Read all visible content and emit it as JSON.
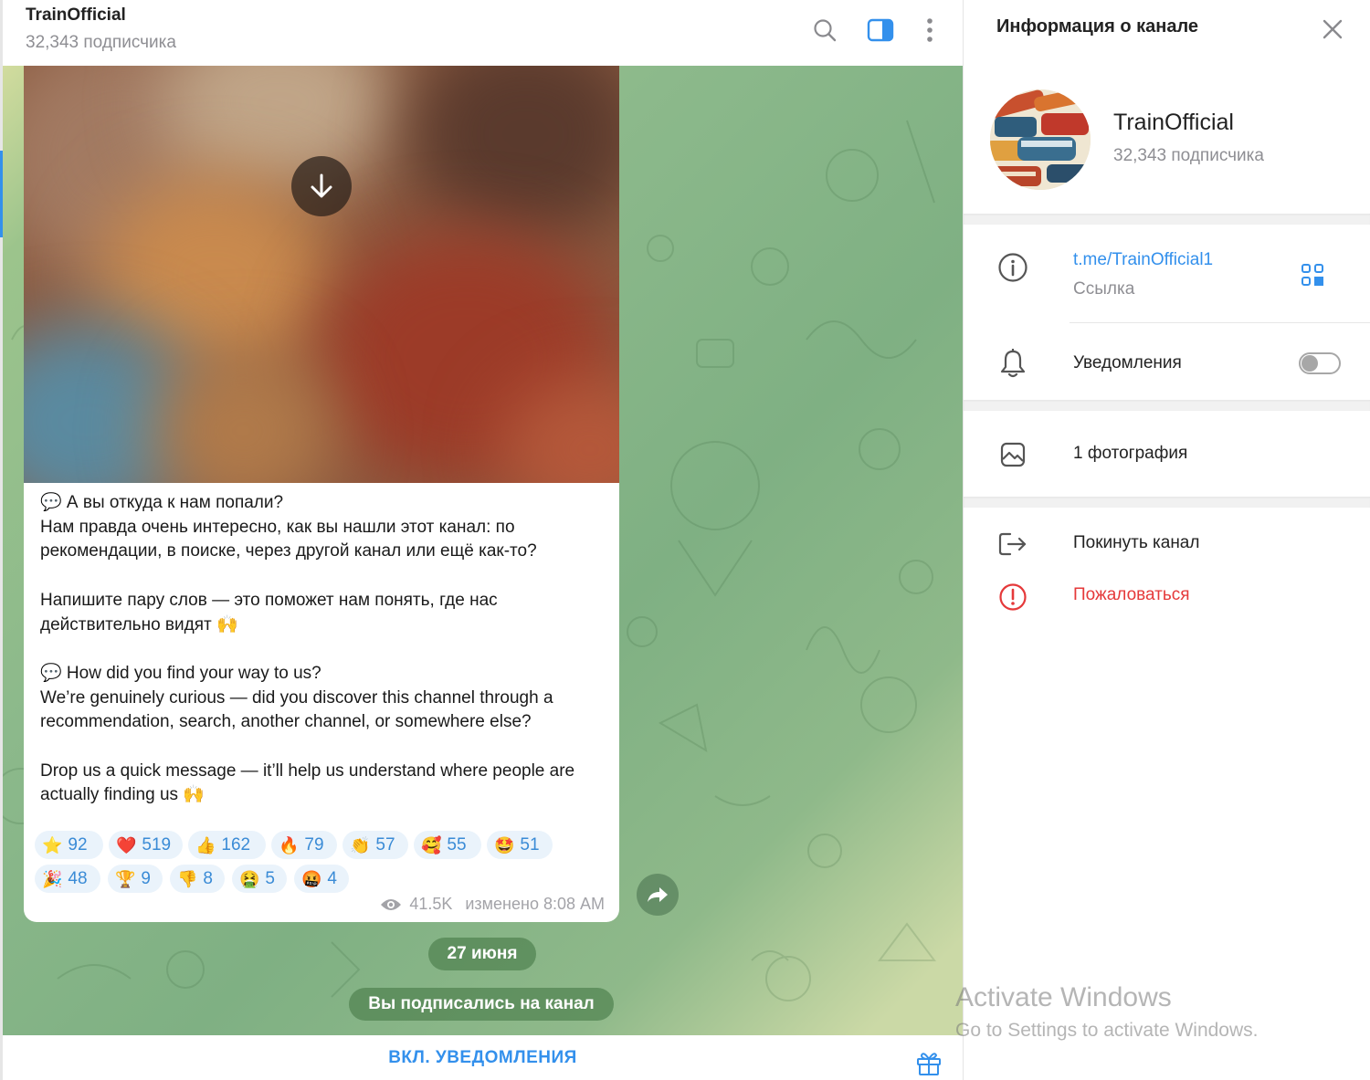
{
  "header": {
    "title": "TrainOfficial",
    "subtitle": "32,343 подписчика",
    "icons": [
      "search-icon",
      "sidebar-toggle-icon",
      "more-vertical-icon"
    ]
  },
  "message": {
    "text": "💬 А вы откуда к нам попали?\nНам правда очень интересно, как вы нашли этот канал: по рекомендации, в поиске, через другой канал или ещё как-то?\n\nНапишите пару слов — это поможет нам понять, где нас действительно видят 🙌\n\n💬 How did you find your way to us?\nWe’re genuinely curious — did you discover this channel through a recommendation, search, another channel, or somewhere else?\n\nDrop us a quick message — it’ll help us understand where people are actually finding us 🙌",
    "reactions": [
      {
        "emoji": "⭐",
        "count": "92"
      },
      {
        "emoji": "❤️",
        "count": "519"
      },
      {
        "emoji": "👍",
        "count": "162"
      },
      {
        "emoji": "🔥",
        "count": "79"
      },
      {
        "emoji": "👏",
        "count": "57"
      },
      {
        "emoji": "🥰",
        "count": "55"
      },
      {
        "emoji": "🤩",
        "count": "51"
      },
      {
        "emoji": "🎉",
        "count": "48"
      },
      {
        "emoji": "🏆",
        "count": "9"
      },
      {
        "emoji": "👎",
        "count": "8"
      },
      {
        "emoji": "🤮",
        "count": "5"
      },
      {
        "emoji": "🤬",
        "count": "4"
      }
    ],
    "views": "41.5K",
    "edited_time": "изменено 8:08 AM"
  },
  "service": {
    "date": "27 июня",
    "joined": "Вы подписались на канал"
  },
  "bottom": {
    "notify_label": "ВКЛ. УВЕДОМЛЕНИЯ"
  },
  "panel": {
    "title": "Информация о канале",
    "channel_name": "TrainOfficial",
    "subscribers": "32,343 подписчика",
    "link": "t.me/TrainOfficial1",
    "link_caption": "Ссылка",
    "notifications_label": "Уведомления",
    "notifications_on": false,
    "photos_label": "1 фотография",
    "leave_label": "Покинуть канал",
    "report_label": "Пожаловаться"
  },
  "watermark": {
    "line1": "Activate Windows",
    "line2": "Go to Settings to activate Windows."
  },
  "colors": {
    "accent": "#3390ec",
    "danger": "#e5393a",
    "reaction_bg": "#eaf3fb"
  }
}
